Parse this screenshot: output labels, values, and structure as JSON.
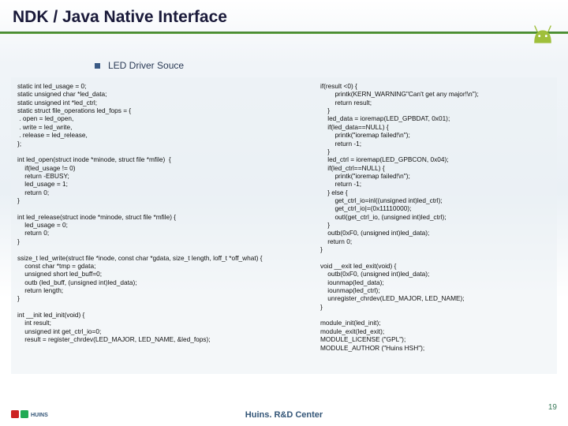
{
  "title": "NDK / Java Native Interface",
  "bullet": "LED Driver Souce",
  "code_left": "static int led_usage = 0;\nstatic unsigned char *led_data;\nstatic unsigned int *led_ctrl;\nstatic struct file_operations led_fops = {\n . open = led_open,\n . write = led_write,\n . release = led_release,\n};\n\nint led_open(struct inode *minode, struct file *mfile)  {\n    if(led_usage != 0)\n    return -EBUSY;\n    led_usage = 1;\n    return 0;\n}\n\nint led_release(struct inode *minode, struct file *mfile) {\n    led_usage = 0;\n    return 0;\n}\n\nssize_t led_write(struct file *inode, const char *gdata, size_t length, loff_t *off_what) {\n    const char *tmp = gdata;\n    unsigned short led_buff=0;\n    outb (led_buff, (unsigned int)led_data);\n    return length;\n}\n\nint __init led_init(void) {\n    int result;\n    unsigned int get_ctrl_io=0;\n    result = register_chrdev(LED_MAJOR, LED_NAME, &led_fops);",
  "code_right": "if(result <0) {\n        printk(KERN_WARNING\"Can't get any major!\\n\");\n        return result;\n    }\n    led_data = ioremap(LED_GPBDAT, 0x01);\n    if(led_data==NULL) {\n        printk(\"ioremap failed!\\n\");\n        return -1;\n    }\n    led_ctrl = ioremap(LED_GPBCON, 0x04);\n    if(led_ctrl==NULL) {\n        printk(\"ioremap failed!\\n\");\n        return -1;\n    } else {\n        get_ctrl_io=inl((unsigned int)led_ctrl);\n        get_ctrl_io|=(0x11110000);\n        outl(get_ctrl_io, (unsigned int)led_ctrl);\n    }\n    outb(0xF0, (unsigned int)led_data);\n    return 0;\n}\n\nvoid __exit led_exit(void) {\n    outb(0xF0, (unsigned int)led_data);\n    iounmap(led_data);\n    iounmap(led_ctrl);\n    unregister_chrdev(LED_MAJOR, LED_NAME);\n}\n\nmodule_init(led_init);\nmodule_exit(led_exit);\nMODULE_LICENSE (\"GPL\");\nMODULE_AUTHOR (\"Huins HSH\");",
  "footer": "Huins. R&D Center",
  "page_number": "19",
  "logo_text": "HUINS"
}
